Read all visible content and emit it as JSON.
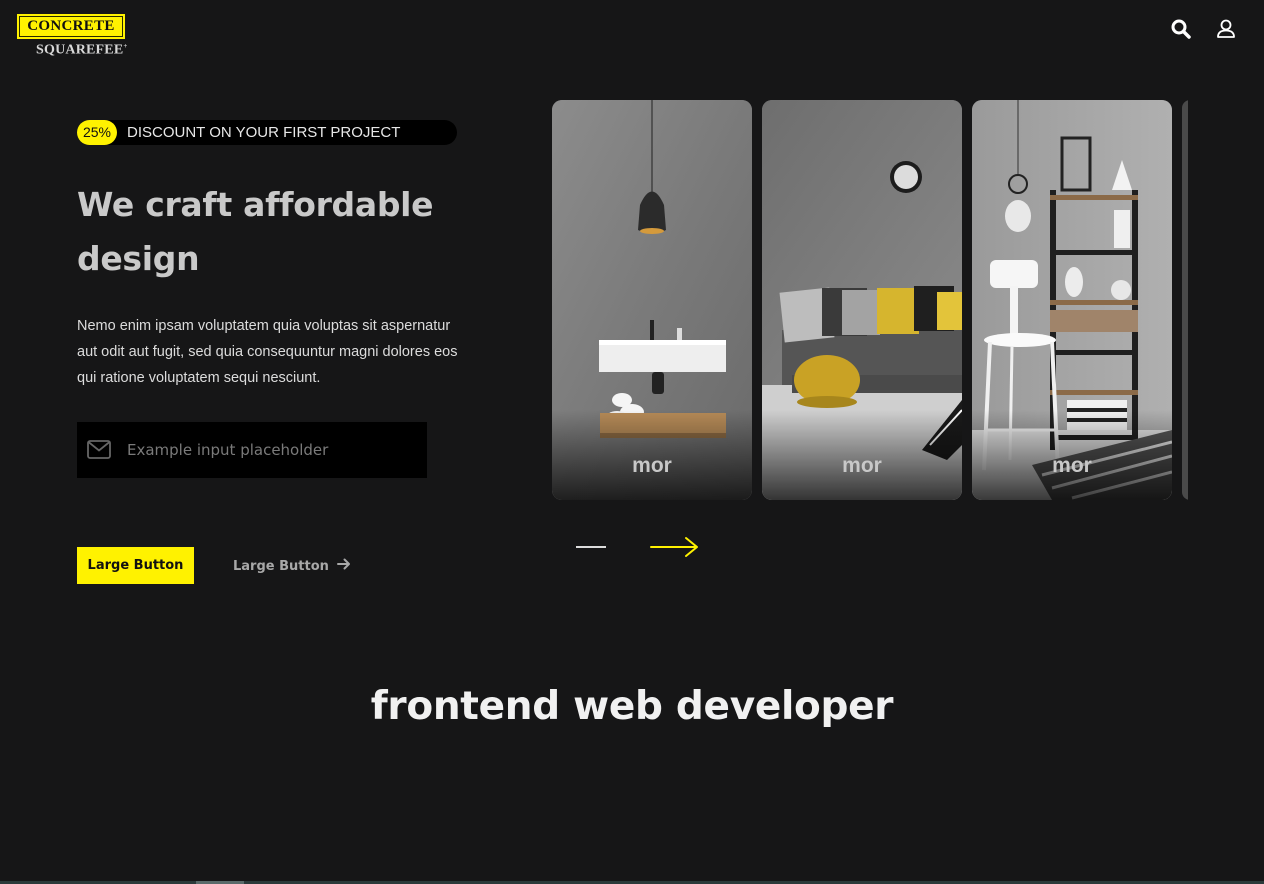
{
  "brand": {
    "top": "CONCRETE",
    "bottom": "SQUAREFEE",
    "mark": "+"
  },
  "colors": {
    "accent": "#fff200",
    "background": "#161617"
  },
  "header": {
    "search_icon": "search-icon",
    "user_icon": "user-icon"
  },
  "hero": {
    "badge_percent": "25%",
    "badge_text": "DISCOUNT ON YOUR FIRST PROJECT",
    "title": "We craft affordable design",
    "description": "Nemo enim ipsam voluptatem quia voluptas sit aspernatur aut odit aut fugit, sed quia consequuntur magni dolores eos qui ratione voluptatem sequi nesciunt.",
    "email_placeholder": "Example input placeholder",
    "primary_button": "Large Button",
    "secondary_button": "Large Button"
  },
  "cards": [
    {
      "label": "mor",
      "scene": "bathroom-sink"
    },
    {
      "label": "mor",
      "scene": "living-room-sofa"
    },
    {
      "label": "mor",
      "scene": "shelf-and-stool"
    }
  ],
  "section": {
    "title": "frontend web developer"
  }
}
